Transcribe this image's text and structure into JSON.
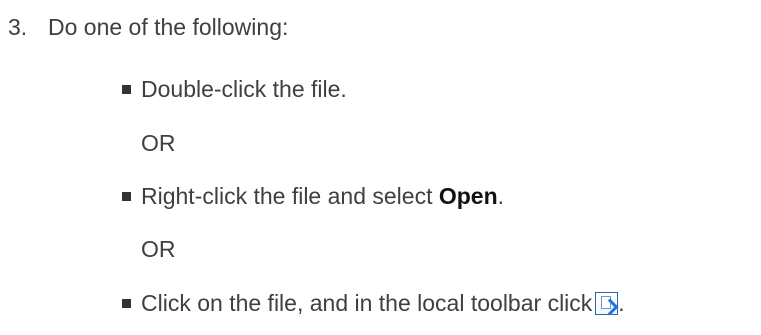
{
  "step": {
    "number": "3.",
    "text": "Do one of the following:"
  },
  "items": [
    {
      "text": "Double-click the file."
    },
    {
      "text_before": "Right-click the file and select ",
      "emphasis": "Open",
      "text_after": "."
    },
    {
      "text": "Click on the file, and in the local toolbar click",
      "icon": "open-file-icon",
      "text_after": "."
    }
  ],
  "separator": "OR"
}
